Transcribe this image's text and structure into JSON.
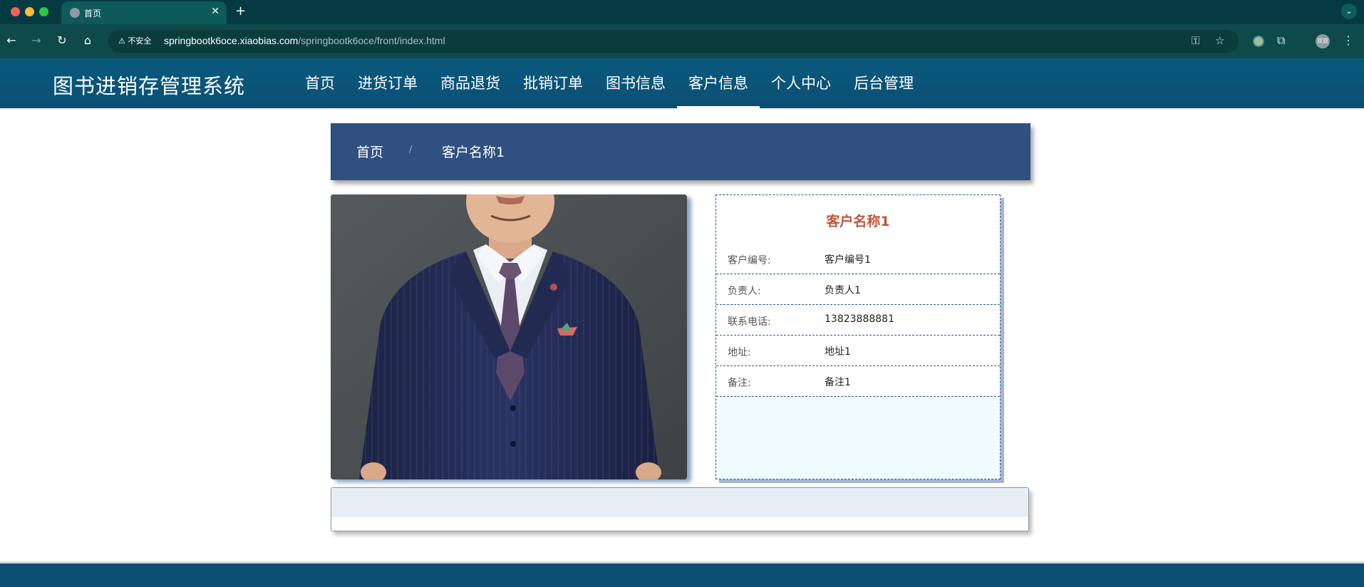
{
  "browser": {
    "tab_title": "首页",
    "tab_close": "✕",
    "new_tab": "+",
    "security_label": "不安全",
    "url_host": "springbootk6oce.xiaobias.com",
    "url_path": "/springbootk6oce/front/index.html",
    "profile_initials": "双双"
  },
  "site": {
    "title": "图书进销存管理系统",
    "menu": [
      {
        "label": "首页"
      },
      {
        "label": "进货订单"
      },
      {
        "label": "商品退货"
      },
      {
        "label": "批销订单"
      },
      {
        "label": "图书信息"
      },
      {
        "label": "客户信息",
        "active": true
      },
      {
        "label": "个人中心"
      },
      {
        "label": "后台管理"
      }
    ]
  },
  "breadcrumb": {
    "home": "首页",
    "separator": "/",
    "current": "客户名称1"
  },
  "detail": {
    "title": "客户名称1",
    "fields": [
      {
        "label": "客户编号:",
        "value": "客户编号1"
      },
      {
        "label": "负责人:",
        "value": "负责人1"
      },
      {
        "label": "联系电话:",
        "value": "13823888881"
      },
      {
        "label": "地址:",
        "value": "地址1"
      },
      {
        "label": "备注:",
        "value": "备注1"
      }
    ]
  },
  "colors": {
    "header_bg": "#0b4f73",
    "breadcrumb_bg": "#2f5080",
    "title_accent": "#c0553a",
    "browser_tab_bar": "#063a42"
  }
}
